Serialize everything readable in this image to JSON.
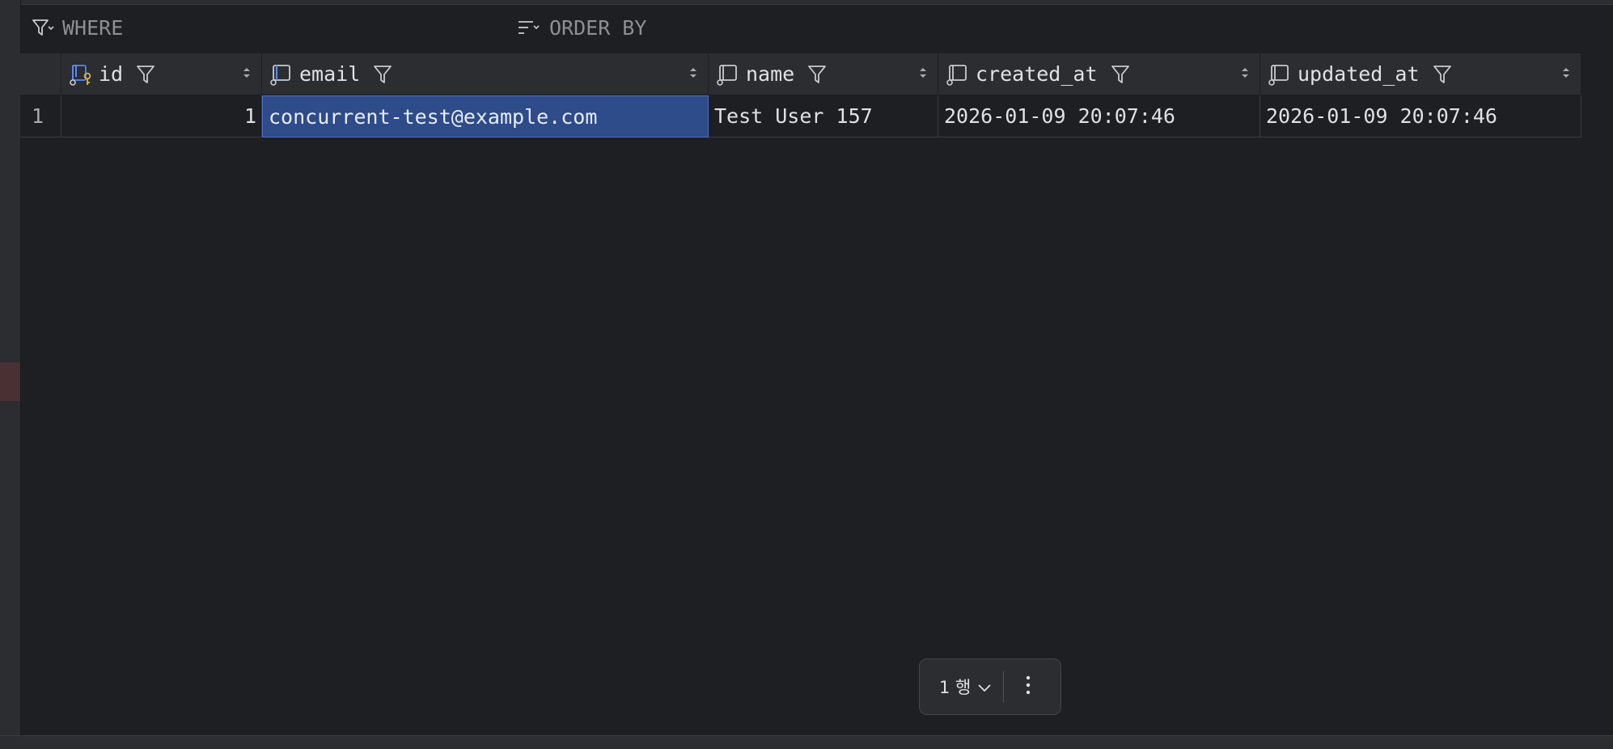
{
  "filters": {
    "where_label": "WHERE",
    "order_by_label": "ORDER BY"
  },
  "columns": [
    {
      "key": "id",
      "label": "id",
      "icon": "primary-key-column-icon"
    },
    {
      "key": "email",
      "label": "email",
      "icon": "column-icon"
    },
    {
      "key": "name",
      "label": "name",
      "icon": "column-icon"
    },
    {
      "key": "created_at",
      "label": "created_at",
      "icon": "column-icon"
    },
    {
      "key": "updated_at",
      "label": "updated_at",
      "icon": "column-icon"
    }
  ],
  "rows": [
    {
      "row_number": "1",
      "id": "1",
      "email": "concurrent-test@example.com",
      "name": "Test User 157",
      "created_at": "2026-01-09 20:07:46",
      "updated_at": "2026-01-09 20:07:46"
    }
  ],
  "selected_cell": {
    "row": 0,
    "column": "email"
  },
  "pager": {
    "count_label": "1 행"
  },
  "colors": {
    "background": "#1e1f22",
    "header": "#2b2d30",
    "selection": "#2e4b8a",
    "key_accent": "#e2b340",
    "column_icon_accent": "#548af7"
  }
}
